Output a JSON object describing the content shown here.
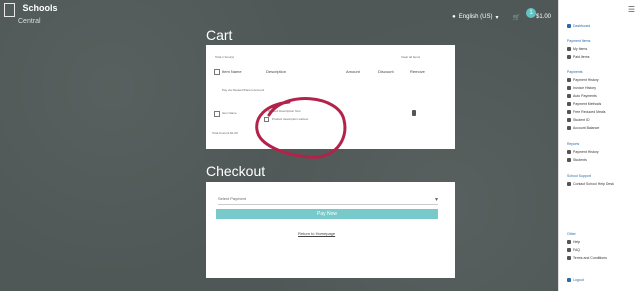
{
  "app": {
    "name": "Schools",
    "subtitle": "Central"
  },
  "topbar": {
    "language": "English (US)",
    "cart_count": "1",
    "cart_total": "$1.00"
  },
  "cart": {
    "title": "Cart",
    "summary_left": "Total 1 Item(s)",
    "summary_right": "Clear all Items",
    "columns": [
      "Item Name",
      "Description",
      "Amount",
      "Discount",
      "Remove"
    ],
    "note": "Pay via Student/Parent Account",
    "row": {
      "item_name": "Item Name",
      "description_line1": "Product Description Text",
      "description_line2": "Product description subtext"
    },
    "subtotal_label": "Total Amount $1.00"
  },
  "checkout": {
    "title": "Checkout",
    "payment_method_placeholder": "Select Payment",
    "pay_button": "Pay Now",
    "back_link": "Return to Homepage"
  },
  "sidebar": {
    "dashboard": "Dashboard",
    "groups": [
      {
        "title": "Payment Items",
        "items": [
          "My Items",
          "Paid Items"
        ]
      },
      {
        "title": "Payments",
        "items": [
          "Payment History",
          "Invoice History",
          "Auto Payments",
          "Payment Methods",
          "Free Reduced Meals",
          "Student ID",
          "Account Balance"
        ]
      },
      {
        "title": "Reports",
        "items": [
          "Payment History",
          "Students"
        ]
      },
      {
        "title": "School Support",
        "items": [
          "Contact School Help Desk"
        ]
      },
      {
        "title": "Other",
        "items": [
          "Help",
          "FAQ",
          "Terms and Conditions"
        ]
      }
    ],
    "footer": "Logout"
  },
  "colors": {
    "background": "#4f5856",
    "accent": "#78c9c9",
    "annotation_mark": "#b3224a"
  }
}
